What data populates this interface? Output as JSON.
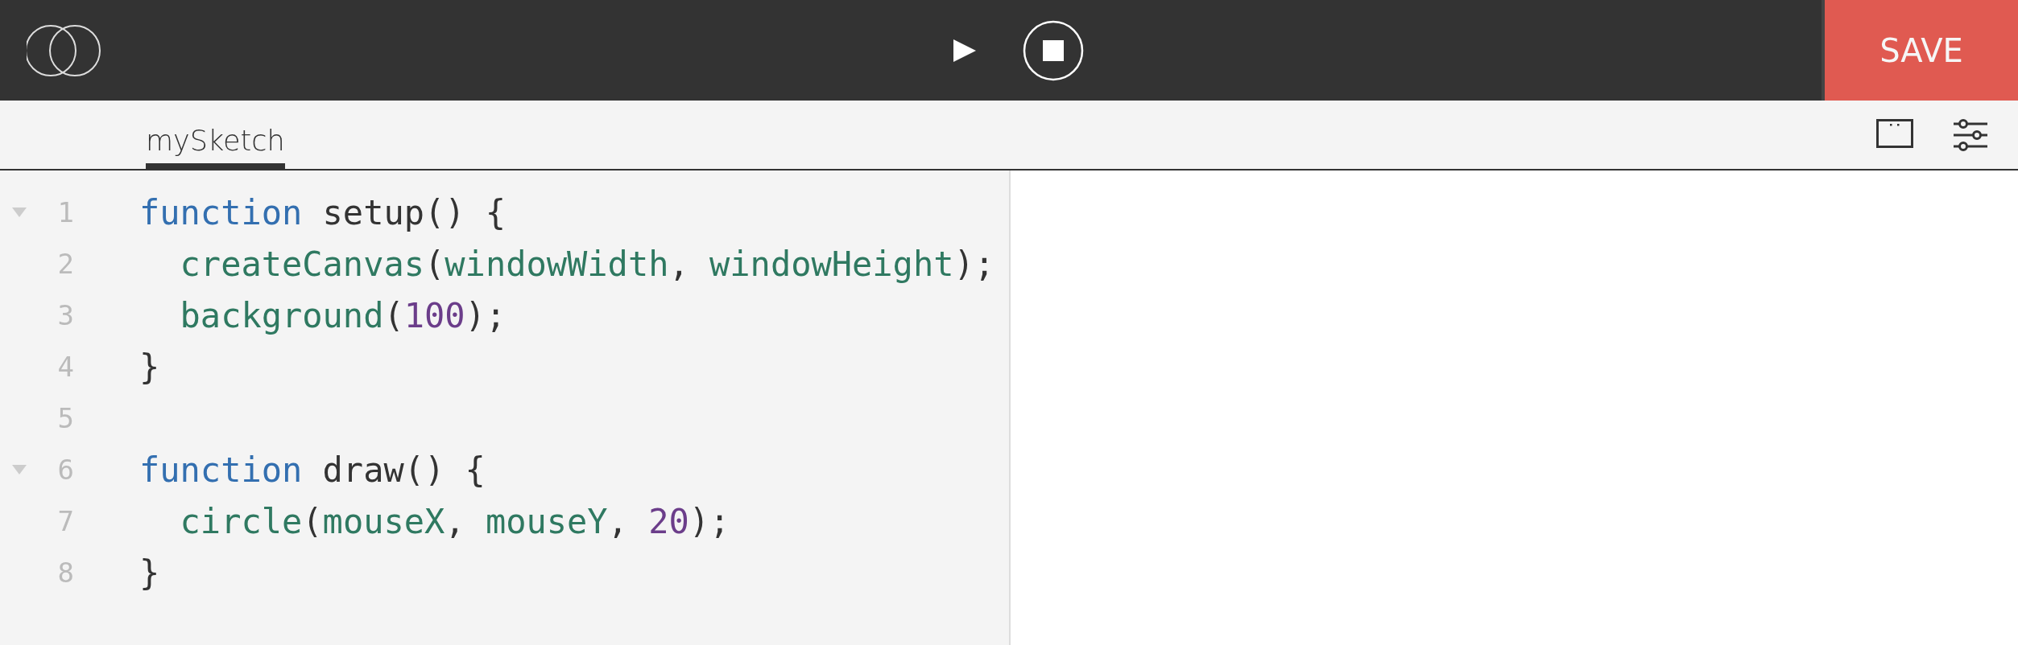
{
  "toolbar": {
    "save_label": "SAVE"
  },
  "tabs": [
    {
      "label": "mySketch",
      "selected": true
    }
  ],
  "editor": {
    "lines": [
      {
        "number": "1",
        "foldable": true,
        "tokens": [
          {
            "kind": "keyword",
            "text": "function"
          },
          {
            "kind": "plain",
            "text": " setup() {"
          }
        ]
      },
      {
        "number": "2",
        "foldable": false,
        "tokens": [
          {
            "kind": "call",
            "text": "  createCanvas"
          },
          {
            "kind": "plain",
            "text": "("
          },
          {
            "kind": "call",
            "text": "windowWidth"
          },
          {
            "kind": "plain",
            "text": ", "
          },
          {
            "kind": "call",
            "text": "windowHeight"
          },
          {
            "kind": "plain",
            "text": ");"
          }
        ]
      },
      {
        "number": "3",
        "foldable": false,
        "tokens": [
          {
            "kind": "call",
            "text": "  background"
          },
          {
            "kind": "plain",
            "text": "("
          },
          {
            "kind": "number",
            "text": "100"
          },
          {
            "kind": "plain",
            "text": ");"
          }
        ]
      },
      {
        "number": "4",
        "foldable": false,
        "tokens": [
          {
            "kind": "plain",
            "text": "}"
          }
        ]
      },
      {
        "number": "5",
        "foldable": false
      },
      {
        "number": "6",
        "foldable": true,
        "tokens": [
          {
            "kind": "keyword",
            "text": "function"
          },
          {
            "kind": "plain",
            "text": " draw() {"
          }
        ]
      },
      {
        "number": "7",
        "foldable": false,
        "tokens": [
          {
            "kind": "call",
            "text": "  circle"
          },
          {
            "kind": "plain",
            "text": "("
          },
          {
            "kind": "call",
            "text": "mouseX"
          },
          {
            "kind": "plain",
            "text": ", "
          },
          {
            "kind": "call",
            "text": "mouseY"
          },
          {
            "kind": "plain",
            "text": ", "
          },
          {
            "kind": "number",
            "text": "20"
          },
          {
            "kind": "plain",
            "text": ");"
          }
        ]
      },
      {
        "number": "8",
        "foldable": false,
        "tokens": [
          {
            "kind": "plain",
            "text": "}"
          }
        ]
      }
    ]
  }
}
